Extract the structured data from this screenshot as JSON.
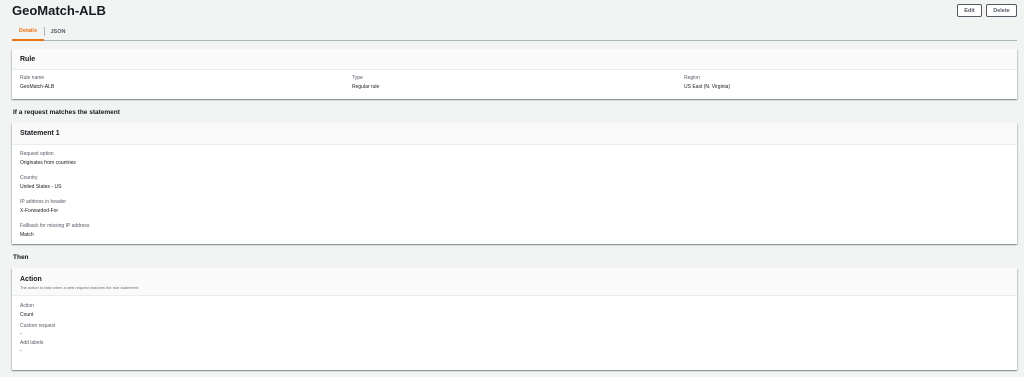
{
  "header": {
    "title": "GeoMatch-ALB",
    "edit_label": "Edit",
    "delete_label": "Delete"
  },
  "tabs": [
    {
      "label": "Details",
      "active": true
    },
    {
      "label": "JSON",
      "active": false
    }
  ],
  "rule_panel": {
    "title": "Rule",
    "fields": [
      {
        "label": "Rule name",
        "value": "GeoMatch-ALB"
      },
      {
        "label": "Type",
        "value": "Regular rule"
      },
      {
        "label": "Region",
        "value": "US East (N. Virginia)"
      }
    ]
  },
  "statement_heading": "If a request matches the statement",
  "statement_panel": {
    "title": "Statement 1",
    "fields": [
      {
        "label": "Request option",
        "value": "Originates from countries"
      },
      {
        "label": "Country",
        "value": "United States - US"
      },
      {
        "label": "IP address in header",
        "value": "X-Forwarded-For"
      },
      {
        "label": "Fallback for missing IP address",
        "value": "Match"
      }
    ]
  },
  "then_heading": "Then",
  "action_panel": {
    "title": "Action",
    "description": "The action to take when a web request matches the rule statement.",
    "fields": [
      {
        "label": "Action",
        "value": "Count"
      },
      {
        "label": "Custom request",
        "value": "-"
      },
      {
        "label": "Add labels",
        "value": "-"
      }
    ]
  },
  "colors": {
    "accent": "#ec7211",
    "background": "#f2f3f3",
    "text": "#16191f",
    "secondary_text": "#545b64"
  }
}
